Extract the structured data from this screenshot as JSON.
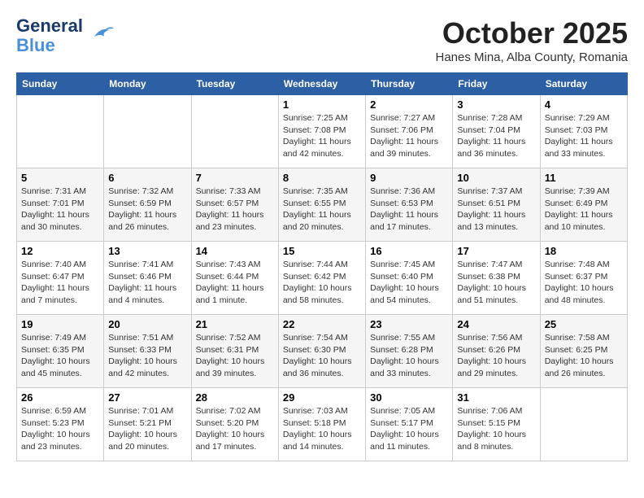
{
  "header": {
    "logo_line1": "General",
    "logo_line2": "Blue",
    "month": "October 2025",
    "location": "Hanes Mina, Alba County, Romania"
  },
  "weekdays": [
    "Sunday",
    "Monday",
    "Tuesday",
    "Wednesday",
    "Thursday",
    "Friday",
    "Saturday"
  ],
  "weeks": [
    [
      {
        "day": "",
        "info": ""
      },
      {
        "day": "",
        "info": ""
      },
      {
        "day": "",
        "info": ""
      },
      {
        "day": "1",
        "info": "Sunrise: 7:25 AM\nSunset: 7:08 PM\nDaylight: 11 hours and 42 minutes."
      },
      {
        "day": "2",
        "info": "Sunrise: 7:27 AM\nSunset: 7:06 PM\nDaylight: 11 hours and 39 minutes."
      },
      {
        "day": "3",
        "info": "Sunrise: 7:28 AM\nSunset: 7:04 PM\nDaylight: 11 hours and 36 minutes."
      },
      {
        "day": "4",
        "info": "Sunrise: 7:29 AM\nSunset: 7:03 PM\nDaylight: 11 hours and 33 minutes."
      }
    ],
    [
      {
        "day": "5",
        "info": "Sunrise: 7:31 AM\nSunset: 7:01 PM\nDaylight: 11 hours and 30 minutes."
      },
      {
        "day": "6",
        "info": "Sunrise: 7:32 AM\nSunset: 6:59 PM\nDaylight: 11 hours and 26 minutes."
      },
      {
        "day": "7",
        "info": "Sunrise: 7:33 AM\nSunset: 6:57 PM\nDaylight: 11 hours and 23 minutes."
      },
      {
        "day": "8",
        "info": "Sunrise: 7:35 AM\nSunset: 6:55 PM\nDaylight: 11 hours and 20 minutes."
      },
      {
        "day": "9",
        "info": "Sunrise: 7:36 AM\nSunset: 6:53 PM\nDaylight: 11 hours and 17 minutes."
      },
      {
        "day": "10",
        "info": "Sunrise: 7:37 AM\nSunset: 6:51 PM\nDaylight: 11 hours and 13 minutes."
      },
      {
        "day": "11",
        "info": "Sunrise: 7:39 AM\nSunset: 6:49 PM\nDaylight: 11 hours and 10 minutes."
      }
    ],
    [
      {
        "day": "12",
        "info": "Sunrise: 7:40 AM\nSunset: 6:47 PM\nDaylight: 11 hours and 7 minutes."
      },
      {
        "day": "13",
        "info": "Sunrise: 7:41 AM\nSunset: 6:46 PM\nDaylight: 11 hours and 4 minutes."
      },
      {
        "day": "14",
        "info": "Sunrise: 7:43 AM\nSunset: 6:44 PM\nDaylight: 11 hours and 1 minute."
      },
      {
        "day": "15",
        "info": "Sunrise: 7:44 AM\nSunset: 6:42 PM\nDaylight: 10 hours and 58 minutes."
      },
      {
        "day": "16",
        "info": "Sunrise: 7:45 AM\nSunset: 6:40 PM\nDaylight: 10 hours and 54 minutes."
      },
      {
        "day": "17",
        "info": "Sunrise: 7:47 AM\nSunset: 6:38 PM\nDaylight: 10 hours and 51 minutes."
      },
      {
        "day": "18",
        "info": "Sunrise: 7:48 AM\nSunset: 6:37 PM\nDaylight: 10 hours and 48 minutes."
      }
    ],
    [
      {
        "day": "19",
        "info": "Sunrise: 7:49 AM\nSunset: 6:35 PM\nDaylight: 10 hours and 45 minutes."
      },
      {
        "day": "20",
        "info": "Sunrise: 7:51 AM\nSunset: 6:33 PM\nDaylight: 10 hours and 42 minutes."
      },
      {
        "day": "21",
        "info": "Sunrise: 7:52 AM\nSunset: 6:31 PM\nDaylight: 10 hours and 39 minutes."
      },
      {
        "day": "22",
        "info": "Sunrise: 7:54 AM\nSunset: 6:30 PM\nDaylight: 10 hours and 36 minutes."
      },
      {
        "day": "23",
        "info": "Sunrise: 7:55 AM\nSunset: 6:28 PM\nDaylight: 10 hours and 33 minutes."
      },
      {
        "day": "24",
        "info": "Sunrise: 7:56 AM\nSunset: 6:26 PM\nDaylight: 10 hours and 29 minutes."
      },
      {
        "day": "25",
        "info": "Sunrise: 7:58 AM\nSunset: 6:25 PM\nDaylight: 10 hours and 26 minutes."
      }
    ],
    [
      {
        "day": "26",
        "info": "Sunrise: 6:59 AM\nSunset: 5:23 PM\nDaylight: 10 hours and 23 minutes."
      },
      {
        "day": "27",
        "info": "Sunrise: 7:01 AM\nSunset: 5:21 PM\nDaylight: 10 hours and 20 minutes."
      },
      {
        "day": "28",
        "info": "Sunrise: 7:02 AM\nSunset: 5:20 PM\nDaylight: 10 hours and 17 minutes."
      },
      {
        "day": "29",
        "info": "Sunrise: 7:03 AM\nSunset: 5:18 PM\nDaylight: 10 hours and 14 minutes."
      },
      {
        "day": "30",
        "info": "Sunrise: 7:05 AM\nSunset: 5:17 PM\nDaylight: 10 hours and 11 minutes."
      },
      {
        "day": "31",
        "info": "Sunrise: 7:06 AM\nSunset: 5:15 PM\nDaylight: 10 hours and 8 minutes."
      },
      {
        "day": "",
        "info": ""
      }
    ]
  ]
}
